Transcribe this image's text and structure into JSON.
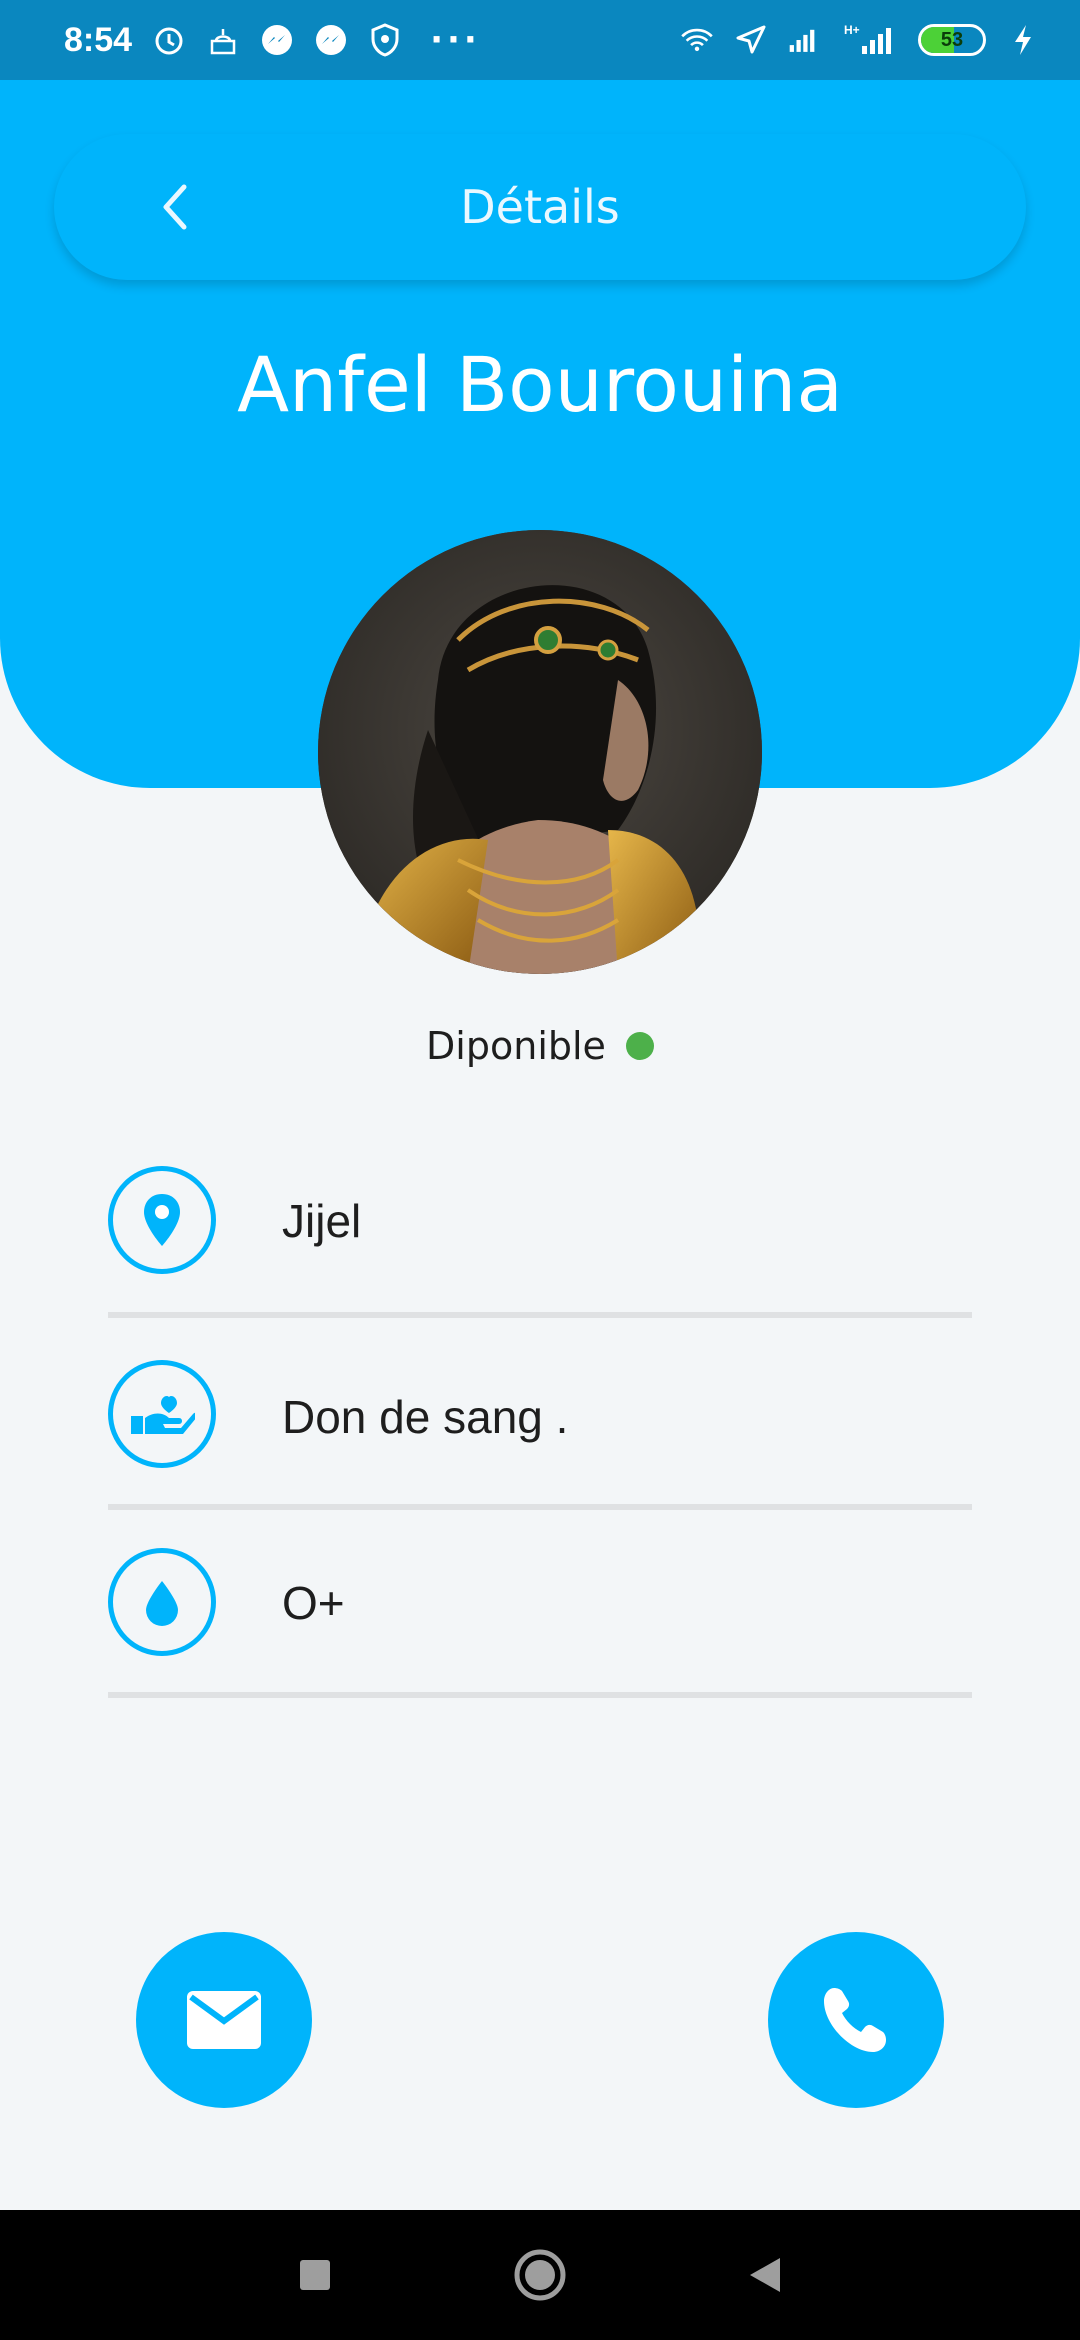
{
  "status_bar": {
    "time": "8:54",
    "battery": "53",
    "battery_level": 0.53,
    "icons": [
      "alarm-icon",
      "mosque-icon",
      "messenger-icon",
      "messenger-icon",
      "shield-icon",
      "more-dots-icon",
      "wifi-icon",
      "location-icon",
      "signal-icon",
      "hplus-signal-icon",
      "battery-icon",
      "charging-icon"
    ],
    "more": "···",
    "network": "H+"
  },
  "header": {
    "title": "Détails",
    "name": "Anfel Bourouina"
  },
  "profile": {
    "status": "Diponible",
    "status_color": "#4db04a"
  },
  "info": {
    "location": "Jijel",
    "service": " Don de sang .",
    "blood_type": "O+"
  },
  "colors": {
    "accent": "#00b4fb",
    "status_bar": "#0a87bf"
  }
}
